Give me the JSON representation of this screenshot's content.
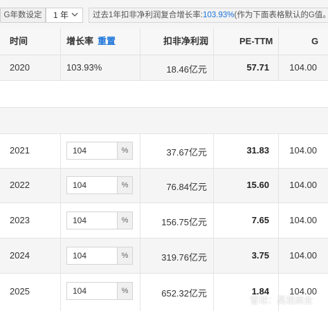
{
  "toolbar": {
    "g_years_label": "G年数设定",
    "g_years_value": "1 年",
    "info_prefix": "过去1年扣非净利润复合增长率:",
    "info_value": "103.93%",
    "info_suffix": "(作为下面表格默认的G值。"
  },
  "table": {
    "headers": {
      "time": "时间",
      "growth": "增长率",
      "reset": "重置",
      "profit": "扣非净利润",
      "pe": "PE-TTM",
      "g": "G"
    },
    "first_row": {
      "year": "2020",
      "growth": "103.93%",
      "profit": "18.46亿元",
      "pe": "57.71",
      "g": "104.00"
    },
    "forecast_rows": [
      {
        "year": "2021",
        "growth_input": "104",
        "unit": "%",
        "profit": "37.67亿元",
        "pe": "31.83",
        "g": "104.00"
      },
      {
        "year": "2022",
        "growth_input": "104",
        "unit": "%",
        "profit": "76.84亿元",
        "pe": "15.60",
        "g": "104.00"
      },
      {
        "year": "2023",
        "growth_input": "104",
        "unit": "%",
        "profit": "156.75亿元",
        "pe": "7.65",
        "g": "104.00"
      },
      {
        "year": "2024",
        "growth_input": "104",
        "unit": "%",
        "profit": "319.76亿元",
        "pe": "3.75",
        "g": "104.00"
      },
      {
        "year": "2025",
        "growth_input": "104",
        "unit": "%",
        "profit": "652.32亿元",
        "pe": "1.84",
        "g": "104.00"
      }
    ]
  },
  "watermark": {
    "text": "雪球：昊观商业",
    "icon": "snowball-logo-icon"
  },
  "colors": {
    "accent_blue": "#1a73d9",
    "header_bg": "#f7f7f7",
    "row_shade": "#f5f5f5",
    "grid": "#e3e3e3"
  }
}
